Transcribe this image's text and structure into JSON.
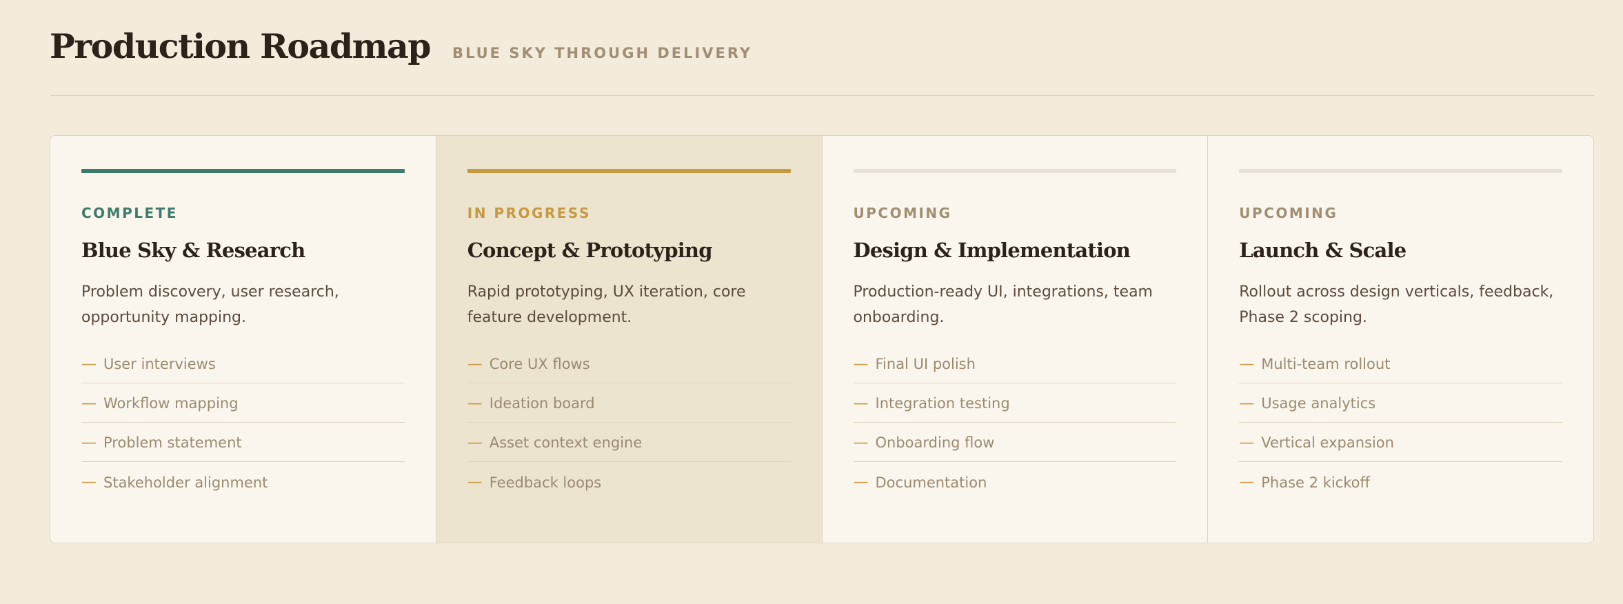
{
  "header": {
    "title": "Production Roadmap",
    "subtitle": "BLUE SKY THROUGH DELIVERY"
  },
  "colors": {
    "background": "#f3ecdc",
    "complete": "#3f7b6c",
    "in_progress": "#c69a41",
    "upcoming": "#a08f73",
    "upcoming_bar": "#e7e1d6",
    "active_panel": "#ede4d0",
    "panel": "#faf6ee"
  },
  "phases": [
    {
      "status": "COMPLETE",
      "status_color": "#3f7b6c",
      "bar_color": "#3f7b6c",
      "active": false,
      "title": "Blue Sky & Research",
      "description": "Problem discovery, user research, opportunity mapping.",
      "tasks": [
        "User interviews",
        "Workflow mapping",
        "Problem statement",
        "Stakeholder alignment"
      ]
    },
    {
      "status": "IN PROGRESS",
      "status_color": "#c69a41",
      "bar_color": "#c69a41",
      "active": true,
      "title": "Concept & Prototyping",
      "description": "Rapid prototyping, UX iteration, core feature development.",
      "tasks": [
        "Core UX flows",
        "Ideation board",
        "Asset context engine",
        "Feedback loops"
      ]
    },
    {
      "status": "UPCOMING",
      "status_color": "#a08f73",
      "bar_color": "#e7e1d6",
      "active": false,
      "title": "Design & Implementation",
      "description": "Production-ready UI, integrations, team onboarding.",
      "tasks": [
        "Final UI polish",
        "Integration testing",
        "Onboarding flow",
        "Documentation"
      ]
    },
    {
      "status": "UPCOMING",
      "status_color": "#a08f73",
      "bar_color": "#e7e1d6",
      "active": false,
      "title": "Launch & Scale",
      "description": "Rollout across design verticals, feedback, Phase 2 scoping.",
      "tasks": [
        "Multi-team rollout",
        "Usage analytics",
        "Vertical expansion",
        "Phase 2 kickoff"
      ]
    }
  ],
  "task_marker": "—"
}
